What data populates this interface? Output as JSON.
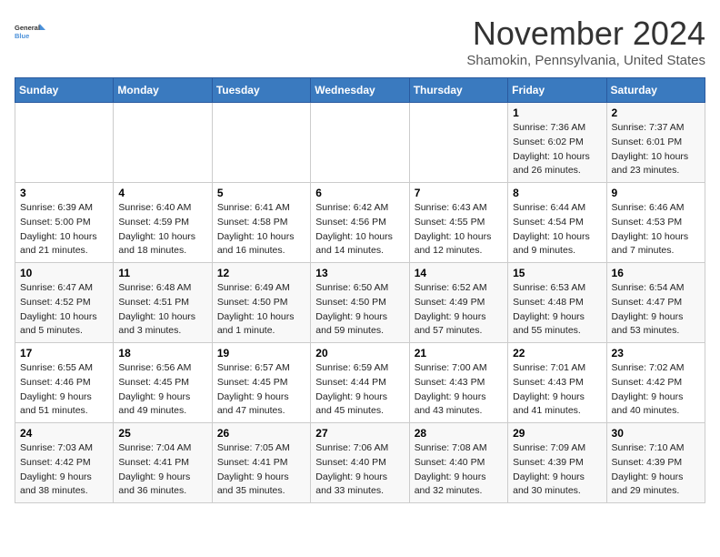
{
  "header": {
    "logo_line1": "General",
    "logo_line2": "Blue",
    "month": "November 2024",
    "location": "Shamokin, Pennsylvania, United States"
  },
  "weekdays": [
    "Sunday",
    "Monday",
    "Tuesday",
    "Wednesday",
    "Thursday",
    "Friday",
    "Saturday"
  ],
  "weeks": [
    [
      {
        "day": "",
        "info": ""
      },
      {
        "day": "",
        "info": ""
      },
      {
        "day": "",
        "info": ""
      },
      {
        "day": "",
        "info": ""
      },
      {
        "day": "",
        "info": ""
      },
      {
        "day": "1",
        "info": "Sunrise: 7:36 AM\nSunset: 6:02 PM\nDaylight: 10 hours\nand 26 minutes."
      },
      {
        "day": "2",
        "info": "Sunrise: 7:37 AM\nSunset: 6:01 PM\nDaylight: 10 hours\nand 23 minutes."
      }
    ],
    [
      {
        "day": "3",
        "info": "Sunrise: 6:39 AM\nSunset: 5:00 PM\nDaylight: 10 hours\nand 21 minutes."
      },
      {
        "day": "4",
        "info": "Sunrise: 6:40 AM\nSunset: 4:59 PM\nDaylight: 10 hours\nand 18 minutes."
      },
      {
        "day": "5",
        "info": "Sunrise: 6:41 AM\nSunset: 4:58 PM\nDaylight: 10 hours\nand 16 minutes."
      },
      {
        "day": "6",
        "info": "Sunrise: 6:42 AM\nSunset: 4:56 PM\nDaylight: 10 hours\nand 14 minutes."
      },
      {
        "day": "7",
        "info": "Sunrise: 6:43 AM\nSunset: 4:55 PM\nDaylight: 10 hours\nand 12 minutes."
      },
      {
        "day": "8",
        "info": "Sunrise: 6:44 AM\nSunset: 4:54 PM\nDaylight: 10 hours\nand 9 minutes."
      },
      {
        "day": "9",
        "info": "Sunrise: 6:46 AM\nSunset: 4:53 PM\nDaylight: 10 hours\nand 7 minutes."
      }
    ],
    [
      {
        "day": "10",
        "info": "Sunrise: 6:47 AM\nSunset: 4:52 PM\nDaylight: 10 hours\nand 5 minutes."
      },
      {
        "day": "11",
        "info": "Sunrise: 6:48 AM\nSunset: 4:51 PM\nDaylight: 10 hours\nand 3 minutes."
      },
      {
        "day": "12",
        "info": "Sunrise: 6:49 AM\nSunset: 4:50 PM\nDaylight: 10 hours\nand 1 minute."
      },
      {
        "day": "13",
        "info": "Sunrise: 6:50 AM\nSunset: 4:50 PM\nDaylight: 9 hours\nand 59 minutes."
      },
      {
        "day": "14",
        "info": "Sunrise: 6:52 AM\nSunset: 4:49 PM\nDaylight: 9 hours\nand 57 minutes."
      },
      {
        "day": "15",
        "info": "Sunrise: 6:53 AM\nSunset: 4:48 PM\nDaylight: 9 hours\nand 55 minutes."
      },
      {
        "day": "16",
        "info": "Sunrise: 6:54 AM\nSunset: 4:47 PM\nDaylight: 9 hours\nand 53 minutes."
      }
    ],
    [
      {
        "day": "17",
        "info": "Sunrise: 6:55 AM\nSunset: 4:46 PM\nDaylight: 9 hours\nand 51 minutes."
      },
      {
        "day": "18",
        "info": "Sunrise: 6:56 AM\nSunset: 4:45 PM\nDaylight: 9 hours\nand 49 minutes."
      },
      {
        "day": "19",
        "info": "Sunrise: 6:57 AM\nSunset: 4:45 PM\nDaylight: 9 hours\nand 47 minutes."
      },
      {
        "day": "20",
        "info": "Sunrise: 6:59 AM\nSunset: 4:44 PM\nDaylight: 9 hours\nand 45 minutes."
      },
      {
        "day": "21",
        "info": "Sunrise: 7:00 AM\nSunset: 4:43 PM\nDaylight: 9 hours\nand 43 minutes."
      },
      {
        "day": "22",
        "info": "Sunrise: 7:01 AM\nSunset: 4:43 PM\nDaylight: 9 hours\nand 41 minutes."
      },
      {
        "day": "23",
        "info": "Sunrise: 7:02 AM\nSunset: 4:42 PM\nDaylight: 9 hours\nand 40 minutes."
      }
    ],
    [
      {
        "day": "24",
        "info": "Sunrise: 7:03 AM\nSunset: 4:42 PM\nDaylight: 9 hours\nand 38 minutes."
      },
      {
        "day": "25",
        "info": "Sunrise: 7:04 AM\nSunset: 4:41 PM\nDaylight: 9 hours\nand 36 minutes."
      },
      {
        "day": "26",
        "info": "Sunrise: 7:05 AM\nSunset: 4:41 PM\nDaylight: 9 hours\nand 35 minutes."
      },
      {
        "day": "27",
        "info": "Sunrise: 7:06 AM\nSunset: 4:40 PM\nDaylight: 9 hours\nand 33 minutes."
      },
      {
        "day": "28",
        "info": "Sunrise: 7:08 AM\nSunset: 4:40 PM\nDaylight: 9 hours\nand 32 minutes."
      },
      {
        "day": "29",
        "info": "Sunrise: 7:09 AM\nSunset: 4:39 PM\nDaylight: 9 hours\nand 30 minutes."
      },
      {
        "day": "30",
        "info": "Sunrise: 7:10 AM\nSunset: 4:39 PM\nDaylight: 9 hours\nand 29 minutes."
      }
    ]
  ]
}
